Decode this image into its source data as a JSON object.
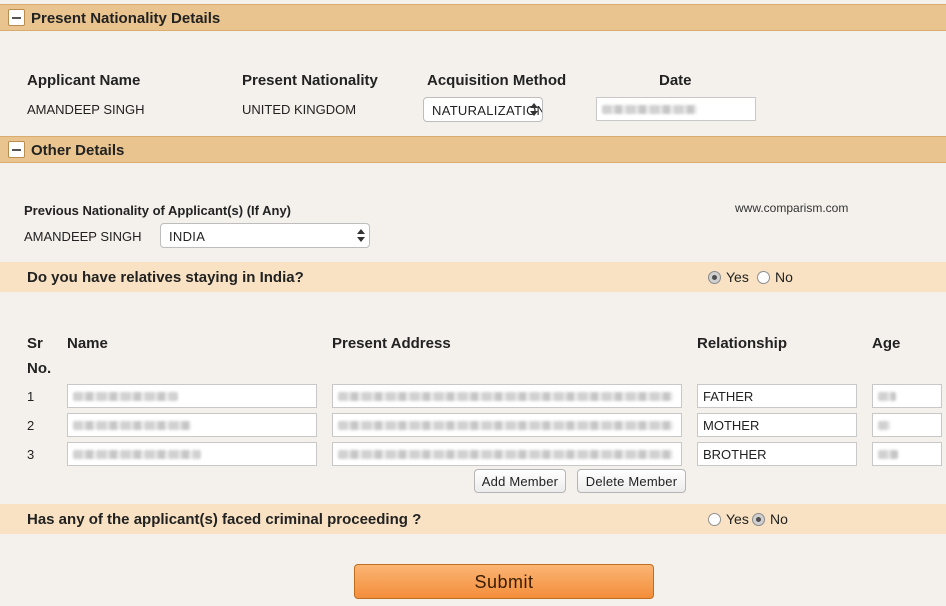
{
  "present_section": {
    "title": "Present Nationality Details",
    "headers": {
      "applicant_name": "Applicant Name",
      "present_nationality": "Present Nationality",
      "acquisition_method": "Acquisition Method",
      "date": "Date"
    },
    "applicant_name": "AMANDEEP SINGH",
    "present_nationality": "UNITED KINGDOM",
    "acquisition_method": "NATURALIZATION",
    "date": ""
  },
  "other_section": {
    "title": "Other Details",
    "previous_label": "Previous Nationality of Applicant(s) (If Any)",
    "applicant_name": "AMANDEEP SINGH",
    "previous_nationality": "INDIA",
    "watermark": "www.comparism.com"
  },
  "relatives": {
    "question": "Do you have relatives staying in India?",
    "yes_label": "Yes",
    "no_label": "No",
    "selected": "Yes",
    "headers": {
      "sr": "Sr",
      "no": "No.",
      "name": "Name",
      "address": "Present Address",
      "relationship": "Relationship",
      "age": "Age"
    },
    "rows": [
      {
        "sr": "1",
        "relationship": "FATHER"
      },
      {
        "sr": "2",
        "relationship": "MOTHER"
      },
      {
        "sr": "3",
        "relationship": "BROTHER"
      }
    ],
    "add_member": "Add Member",
    "delete_member": "Delete Member"
  },
  "criminal": {
    "question": "Has any of the applicant(s) faced criminal proceeding ?",
    "yes_label": "Yes",
    "no_label": "No",
    "selected": "No"
  },
  "submit_label": "Submit"
}
